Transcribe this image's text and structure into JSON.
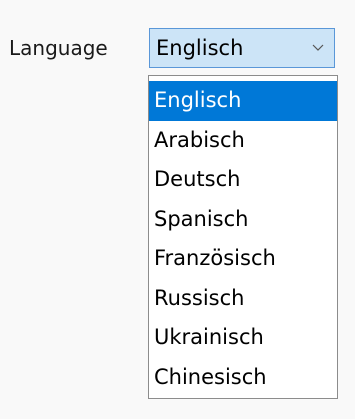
{
  "form": {
    "label": "Language",
    "select": {
      "value": "Englisch",
      "icon": "chevron-down-icon"
    }
  },
  "dropdown": {
    "options": [
      {
        "label": "Englisch",
        "selected": true
      },
      {
        "label": "Arabisch",
        "selected": false
      },
      {
        "label": "Deutsch",
        "selected": false
      },
      {
        "label": "Spanisch",
        "selected": false
      },
      {
        "label": "Französisch",
        "selected": false
      },
      {
        "label": "Russisch",
        "selected": false
      },
      {
        "label": "Ukrainisch",
        "selected": false
      },
      {
        "label": "Chinesisch",
        "selected": false
      }
    ]
  },
  "colors": {
    "select_background": "#cce4f7",
    "select_border": "#5a97d8",
    "highlight": "#0078d7"
  }
}
